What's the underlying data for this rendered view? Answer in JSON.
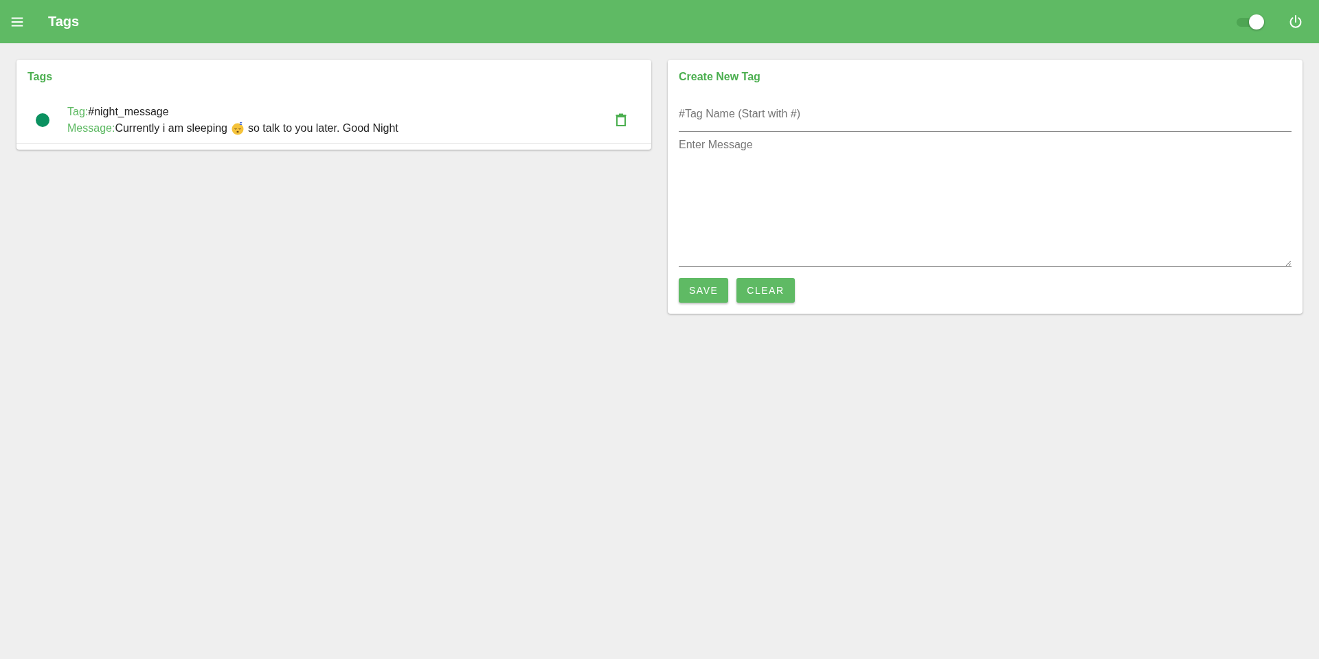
{
  "app_bar": {
    "title": "Tags",
    "toggle": {
      "on": true
    }
  },
  "tags_card": {
    "title": "Tags",
    "items": [
      {
        "color": "#0b9160",
        "tag_label": "Tag:",
        "tag": "#night_message",
        "message_label": "Message:",
        "message_before": "Currently i am sleeping",
        "message_after": "so talk to you later. Good Night"
      }
    ]
  },
  "create_card": {
    "title": "Create New Tag",
    "tag_field": {
      "placeholder": "#Tag Name (Start with #)"
    },
    "message_field": {
      "placeholder": "Enter Message"
    },
    "buttons": [
      "SAVE",
      "CLEAR"
    ]
  }
}
